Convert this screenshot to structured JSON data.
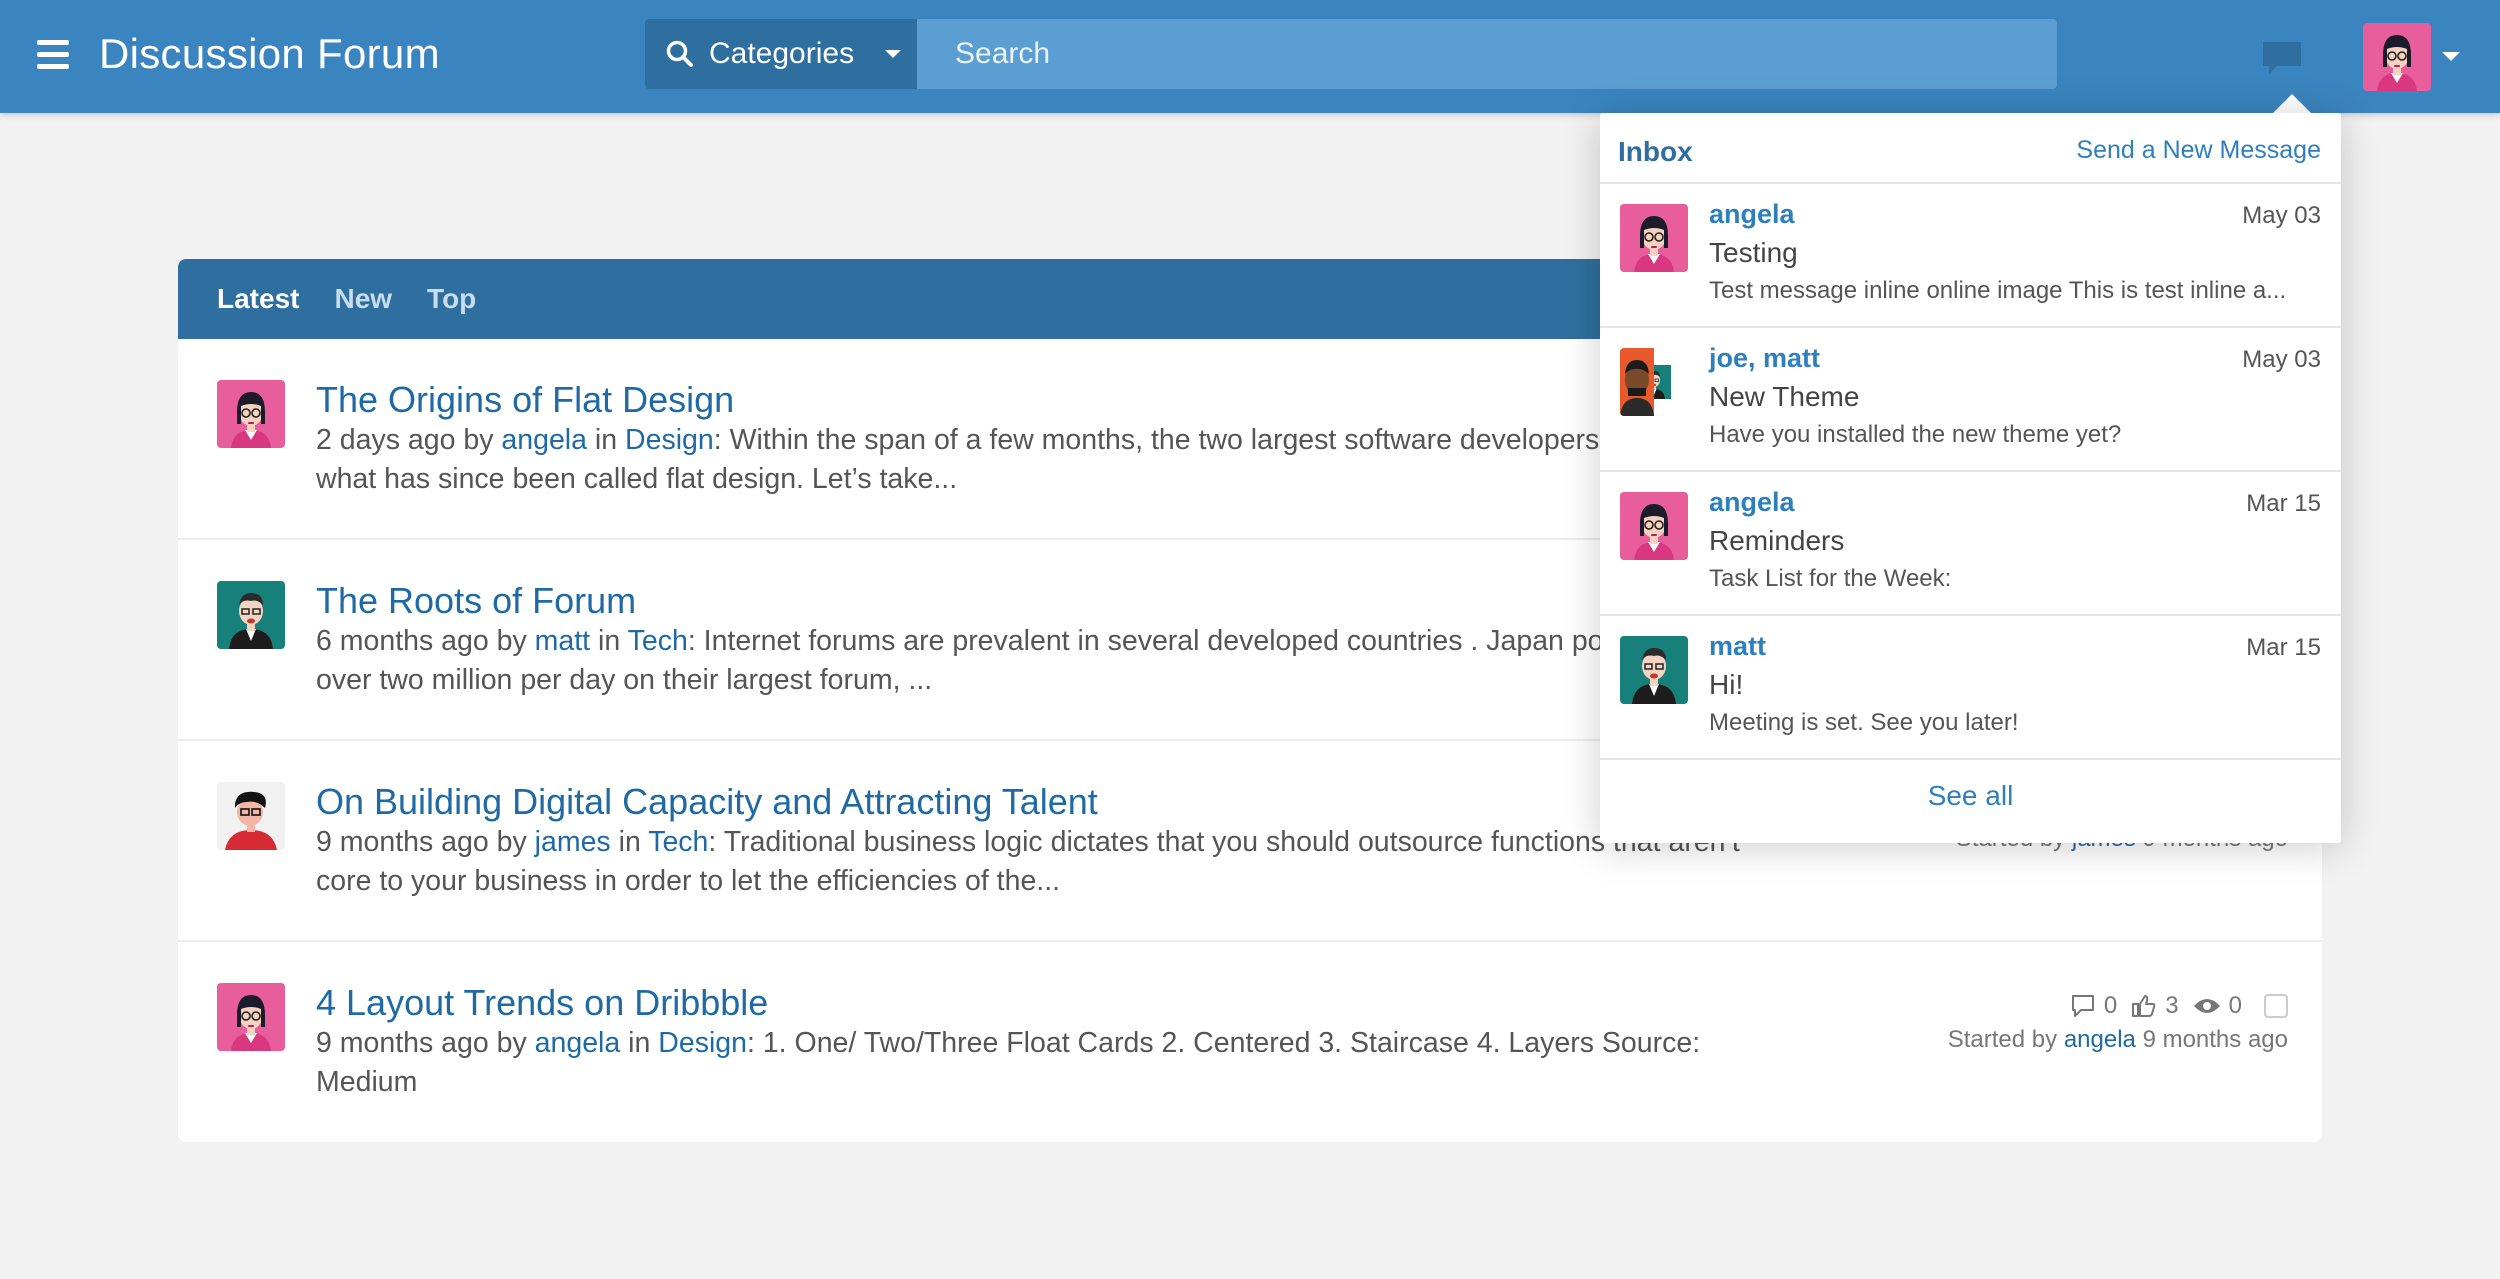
{
  "header": {
    "title": "Discussion Forum",
    "category_label": "Categories",
    "search_placeholder": "Search"
  },
  "tabs": [
    {
      "label": "Latest",
      "active": true
    },
    {
      "label": "New",
      "active": false
    },
    {
      "label": "Top",
      "active": false
    }
  ],
  "topics": [
    {
      "title": "The Origins of Flat Design",
      "age": "2 days ago",
      "by": "by",
      "author": "angela",
      "in": "in",
      "category": "Design",
      "excerpt": ": Within the span of a few months, the two largest software developers started what has since been called flat design. Let’s take...",
      "avatar": "angela"
    },
    {
      "title": "The Roots of Forum",
      "age": "6 months ago",
      "by": "by",
      "author": "matt",
      "in": "in",
      "category": "Tech",
      "excerpt": ": Internet forums are prevalent in several developed countries . Japan posts with over two million per day on their largest forum, ...",
      "avatar": "matt"
    },
    {
      "title": "On Building Digital Capacity and Attracting Talent",
      "age": "9 months ago",
      "by": "by",
      "author": "james",
      "in": "in",
      "category": "Tech",
      "excerpt": ": Traditional business logic dictates that you should outsource functions that aren’t core to your business in order to let the efficiencies of the...",
      "avatar": "james",
      "started_prefix": "Started by",
      "started_author": "james",
      "started_age": "9 months ago"
    },
    {
      "title": "4 Layout Trends on Dribbble",
      "age": "9 months ago",
      "by": "by",
      "author": "angela",
      "in": "in",
      "category": "Design",
      "excerpt": ": 1. One/ Two/Three Float Cards 2. Centered 3. Staircase 4. Layers Source: Medium",
      "avatar": "angela",
      "replies": "0",
      "likes": "3",
      "views": "0",
      "started_prefix": "Started by",
      "started_author": "angela",
      "started_age": "9 months ago"
    }
  ],
  "inbox": {
    "title": "Inbox",
    "send_label": "Send a New Message",
    "see_all": "See all",
    "messages": [
      {
        "from": "angela",
        "date": "May 03",
        "subject": "Testing",
        "preview": "Test message inline online image This is test inline a...",
        "avatar": "angela"
      },
      {
        "from": "joe, matt",
        "date": "May 03",
        "subject": "New Theme",
        "preview": "Have you installed the new theme yet?",
        "avatar": "joe-matt"
      },
      {
        "from": "angela",
        "date": "Mar 15",
        "subject": "Reminders",
        "preview": "Task List for the Week:",
        "avatar": "angela"
      },
      {
        "from": "matt",
        "date": "Mar 15",
        "subject": "Hi!",
        "preview": "Meeting is set. See you later!",
        "avatar": "matt"
      }
    ]
  },
  "colors": {
    "header_bg": "#3a85bf",
    "tabs_bg": "#2f6f9f",
    "link": "#1f6aa5",
    "page_bg": "#f2f2f3"
  }
}
